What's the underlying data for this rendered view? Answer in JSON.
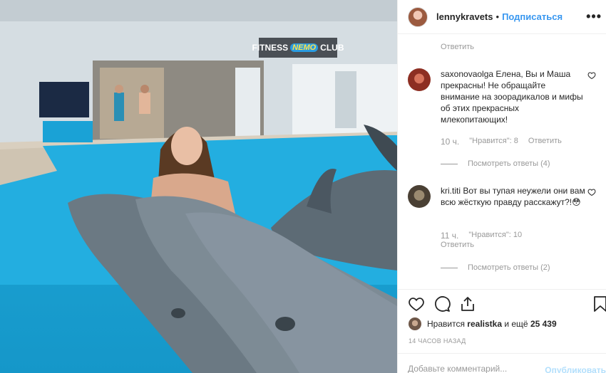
{
  "photo": {
    "sign_text": "FITNESS",
    "sign_logo": "NEMO",
    "sign_club": "CLUB"
  },
  "header": {
    "username": "lennykravets",
    "separator": "•",
    "follow_label": "Подписаться",
    "more_icon": "more-options-icon"
  },
  "comments": {
    "top_reply_label": "Ответить",
    "items": [
      {
        "username": "saxonovaolga",
        "text": "Елена, Вы и Маша прекрасны! Не обращайте внимание на зоорадикалов и мифы об этих прекрасных млекопитающих!",
        "time": "10 ч.",
        "likes": "\"Нравится\": 8",
        "reply": "Ответить",
        "view_replies": "Посмотреть ответы (4)"
      },
      {
        "username": "kri.titi",
        "text": "Вот вы тупая неужели они вам всю жёсткую правду расскажут?!😳",
        "time": "11 ч.",
        "likes": "\"Нравится\": 10",
        "reply": "Ответить",
        "view_replies": "Посмотреть ответы (2)"
      }
    ]
  },
  "likes": {
    "prefix": "Нравится",
    "user": "realistka",
    "middle": "и ещё",
    "count": "25 439"
  },
  "post_time": "14 ЧАСОВ НАЗАД",
  "add_comment": {
    "placeholder": "Добавьте комментарий...",
    "publish_label": "Опубликовать"
  },
  "colors": {
    "accent": "#3897f0",
    "muted": "#999999",
    "pool": "#1ea6d6"
  }
}
